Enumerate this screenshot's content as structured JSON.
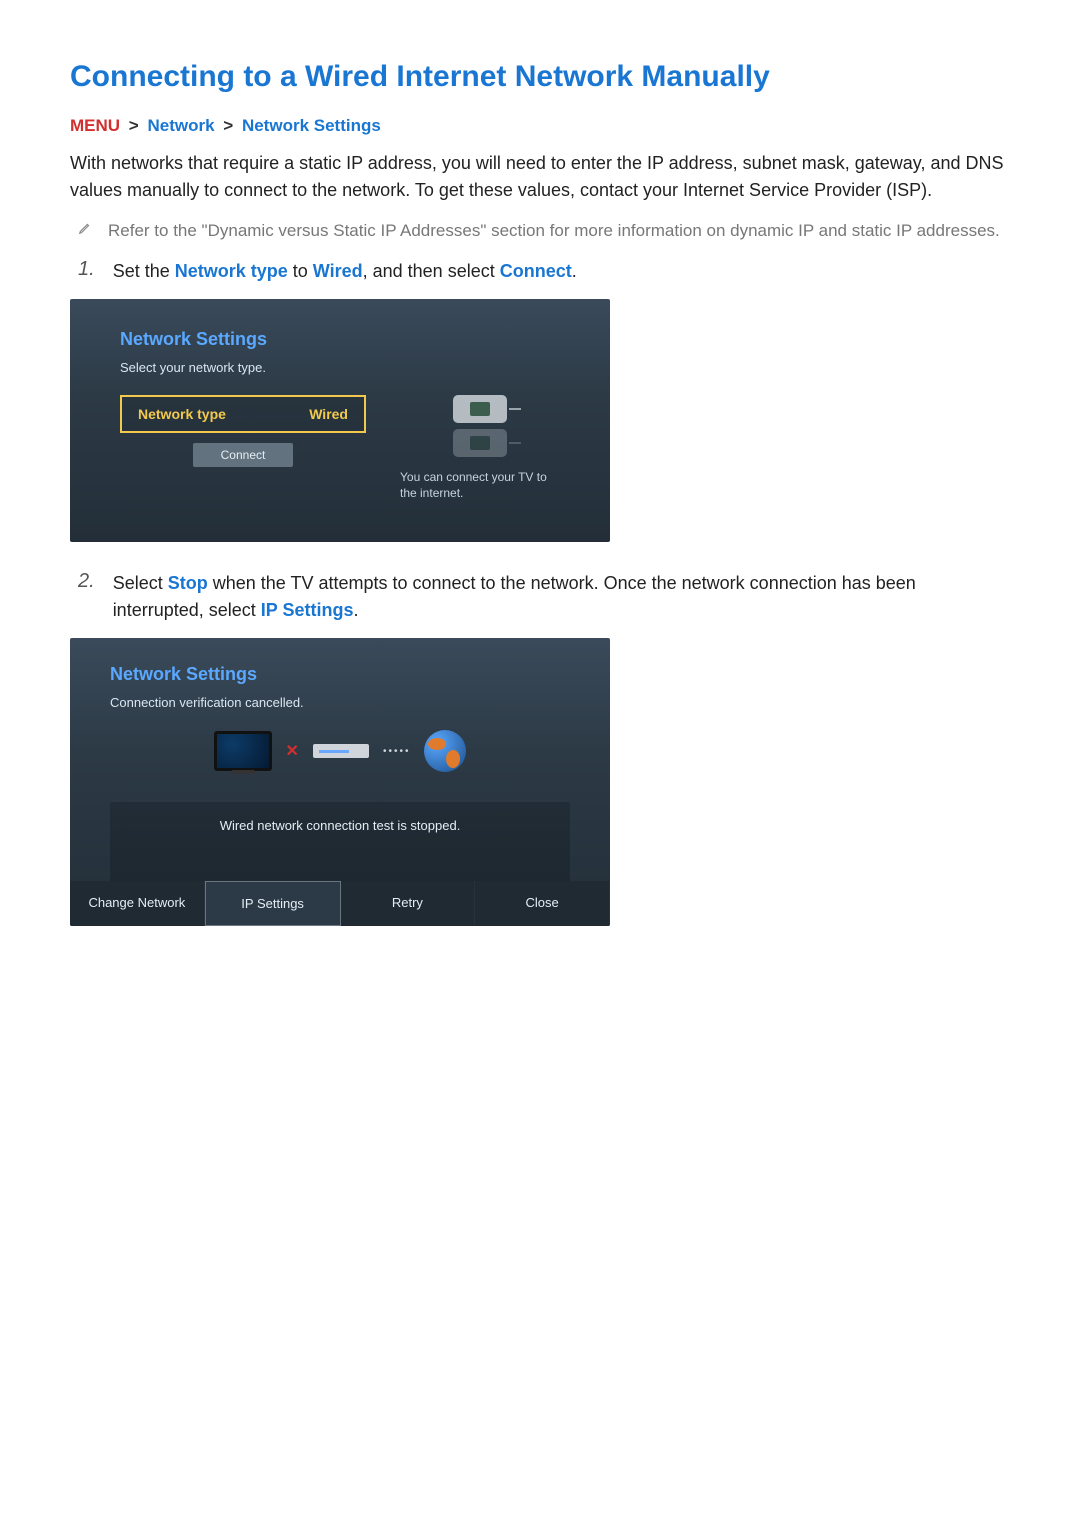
{
  "title": "Connecting to a Wired Internet Network Manually",
  "breadcrumb": {
    "menu": "MENU",
    "item1": "Network",
    "item2": "Network Settings"
  },
  "intro": "With networks that require a static IP address, you will need to enter the IP address, subnet mask, gateway, and DNS values manually to connect to the network. To get these values, contact your Internet Service Provider (ISP).",
  "note": "Refer to the \"Dynamic versus Static IP Addresses\" section for more information on dynamic IP and static IP addresses.",
  "step1": {
    "num": "1.",
    "pre": "Set the ",
    "hl1": "Network type",
    "mid1": " to ",
    "hl2": "Wired",
    "mid2": ", and then select ",
    "hl3": "Connect",
    "end": "."
  },
  "panel1": {
    "title": "Network Settings",
    "subtitle": "Select your network type.",
    "ntLabel": "Network type",
    "ntValue": "Wired",
    "connect": "Connect",
    "msg": "You can connect your TV to the internet."
  },
  "step2": {
    "num": "2.",
    "pre": "Select ",
    "hl1": "Stop",
    "mid1": " when the TV attempts to connect to the network. Once the network connection has been interrupted, select ",
    "hl2": "IP Settings",
    "end": "."
  },
  "panel2": {
    "title": "Network Settings",
    "subtitle": "Connection verification cancelled.",
    "status": "Wired network connection test is stopped.",
    "buttons": {
      "changeNetwork": "Change Network",
      "ipSettings": "IP Settings",
      "retry": "Retry",
      "close": "Close"
    }
  }
}
